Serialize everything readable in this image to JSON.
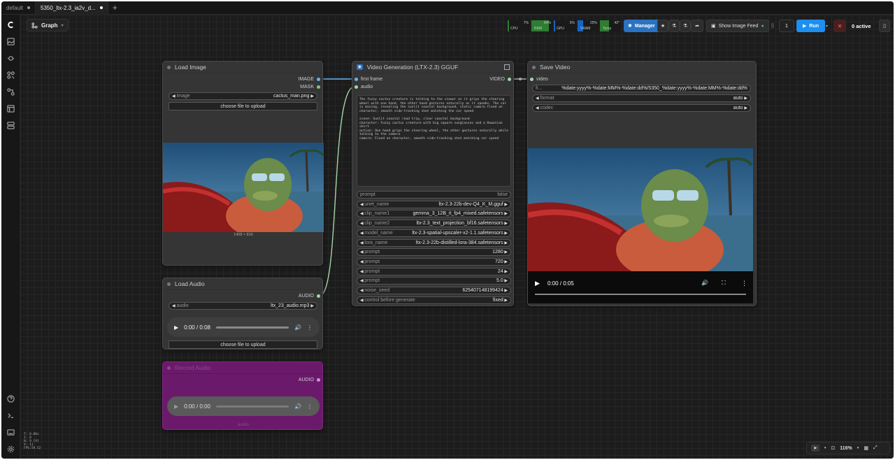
{
  "tabs": [
    {
      "label": "default"
    },
    {
      "label": "5350_ltx-2.3_ia2v_d..."
    }
  ],
  "toolbar": {
    "graph_label": "Graph",
    "meters": [
      {
        "label": "CPU",
        "value": "7%",
        "fill": 0.07
      },
      {
        "label": "RAM",
        "value": "84%",
        "fill": 0.84
      },
      {
        "label": "GPU",
        "value": "5%",
        "fill": 0.05
      },
      {
        "label": "VRAM",
        "value": "25%",
        "fill": 0.25
      },
      {
        "label": "Temp",
        "value": "42°",
        "fill": 0.42
      }
    ],
    "manager_label": "Manager",
    "image_feed_label": "Show Image Feed",
    "queue_count": "1",
    "run_label": "Run",
    "active_label": "0 active"
  },
  "nodes": {
    "load_image": {
      "title": "Load Image",
      "outputs": [
        "IMAGE",
        "MASK"
      ],
      "image_widget": {
        "name": "image",
        "value": "cactus_man.png"
      },
      "upload_label": "choose file to upload",
      "dims": "1408 × 816"
    },
    "load_audio": {
      "title": "Load Audio",
      "output": "AUDIO",
      "audio_widget": {
        "name": "audio",
        "value": "ltx_23_audio.mp3"
      },
      "player_time": "0:00 / 0:08",
      "upload_label": "choose file to upload"
    },
    "record_audio": {
      "title": "Record Audio",
      "output": "AUDIO",
      "player_time": "0:00 / 0:00",
      "footer": "audio"
    },
    "video_gen": {
      "title": "Video Generation (LTX-2.3) GGUF",
      "inputs": [
        "first frame",
        "audio"
      ],
      "output": "VIDEO",
      "prompt_text": "The fuzzy cactus creature is talking to the viewer as it grips the steering wheel with one hand, the other hand gestures naturally as it speaks. The car is moving, revealing the sunlit coastal background, static camera fixed on character, smooth side-tracking shot matching the car speed\n\nscene: Sunlit coastal road trip, clear coastal background\ncharacter: Fuzzy cactus creature with big square sunglasses and a Hawaiian shirt\naction: One hand grips the steering wheel, the other gestures naturally while talking to the camera\ncamera: Fixed on character, smooth side-tracking shot matching car speed",
      "widgets": [
        {
          "name": "prompt",
          "value": "false"
        },
        {
          "name": "unet_name",
          "value": "ltx-2.3-22b-dev-Q4_K_M.gguf"
        },
        {
          "name": "clip_name1",
          "value": "gemma_3_12B_it_fp4_mixed.safetensors"
        },
        {
          "name": "clip_name2",
          "value": "ltx-2.3_text_projection_bf16.safetensors"
        },
        {
          "name": "model_name",
          "value": "ltx-2.3-spatial-upscaler-x2-1.1.safetensors"
        },
        {
          "name": "lora_name",
          "value": "ltx-2.3-22b-distilled-lora-384.safetensors"
        },
        {
          "name": "prompt",
          "value": "1280"
        },
        {
          "name": "prompt",
          "value": "720"
        },
        {
          "name": "prompt",
          "value": "24"
        },
        {
          "name": "prompt",
          "value": "5.0"
        },
        {
          "name": "noise_seed",
          "value": "625407148199424"
        },
        {
          "name": "control before generate",
          "value": "fixed"
        }
      ]
    },
    "save_video": {
      "title": "Save Video",
      "input": "video",
      "filename_prefix": {
        "name": "fi...",
        "value": "%date:yyyy%-%date:MM%-%date:dd%/5350_%date:yyyy%-%date:MM%-%date:dd%"
      },
      "format": {
        "name": "format",
        "value": "auto"
      },
      "codec": {
        "name": "codec",
        "value": "auto"
      },
      "player_time": "0:00 / 0:05"
    }
  },
  "stats": {
    "lines": [
      "T: 0.00s",
      "I: 0",
      "N: 9 [9]",
      "V: 11",
      "FPS:59.52"
    ]
  },
  "bottom_bar": {
    "zoom": "116%"
  },
  "colors": {
    "accent": "#1d8ff0",
    "image_link": "#64b5f6",
    "audio_link": "#a5d6a7",
    "record_node": "#6b1a6b"
  }
}
